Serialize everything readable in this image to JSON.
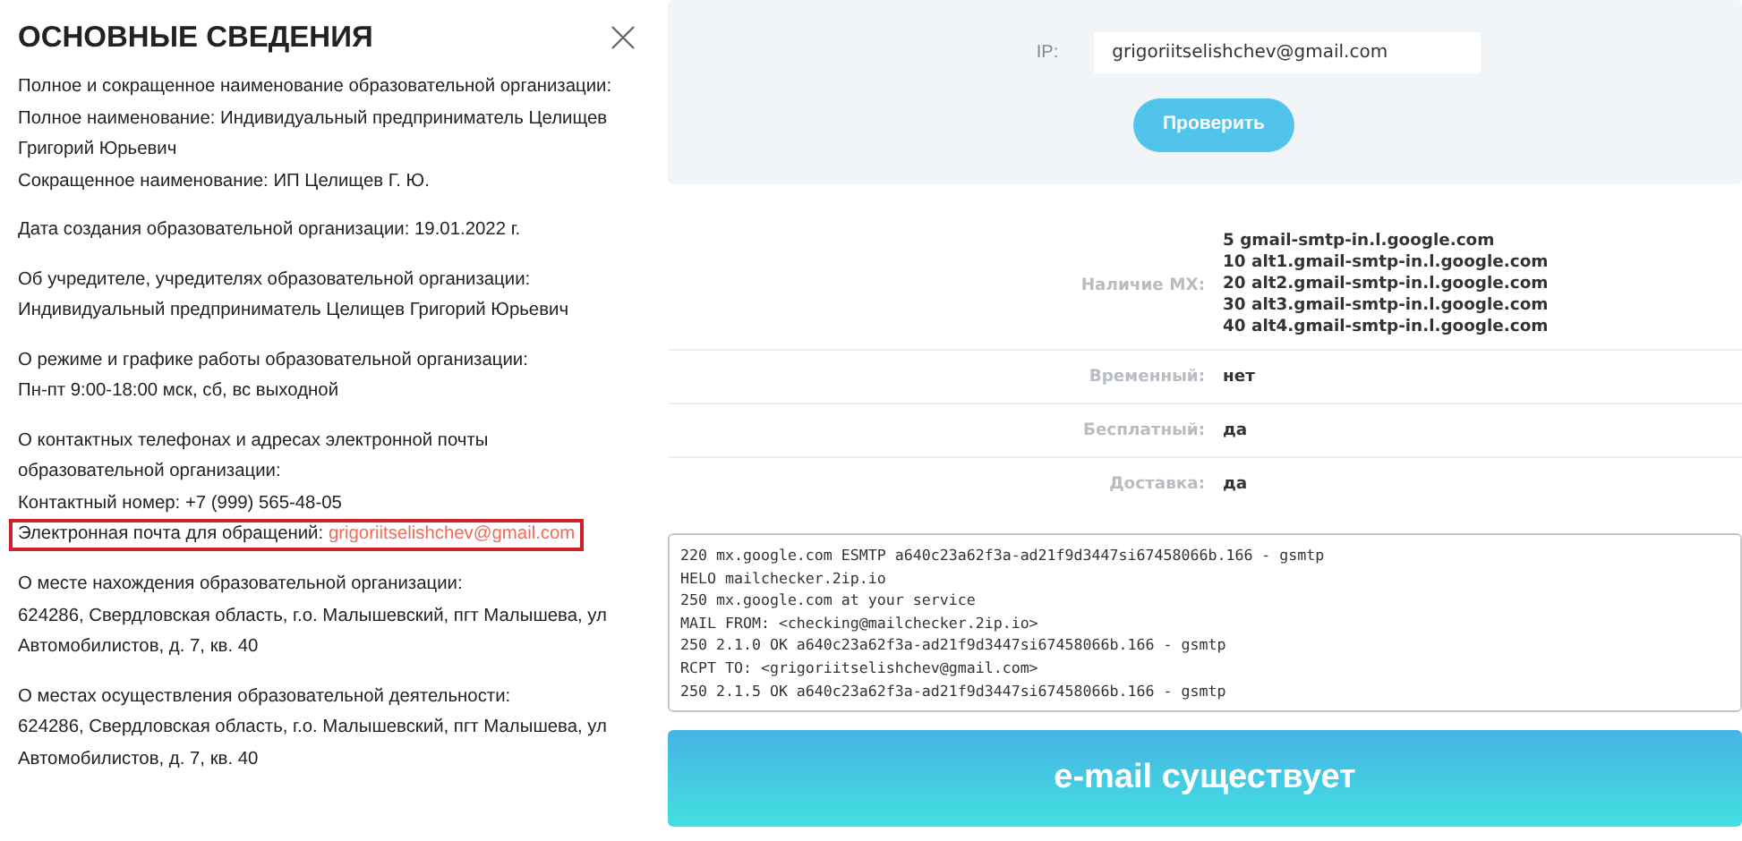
{
  "info_panel": {
    "title": "ОСНОВНЫЕ СВЕДЕНИЯ",
    "sections": [
      {
        "lines": [
          {
            "text": "Полное и сокращенное наименование образовательной организации:"
          },
          {
            "text": "Полное наименование: Индивидуальный предприниматель Целищев Григорий Юрьевич"
          },
          {
            "text": "Сокращенное наименование: ИП Целищев Г. Ю."
          }
        ]
      },
      {
        "lines": [
          {
            "text": "Дата создания образовательной организации: 19.01.2022 г."
          }
        ]
      },
      {
        "lines": [
          {
            "text": "Об учредителе, учредителях образовательной организации:"
          },
          {
            "text": "Индивидуальный предприниматель Целищев Григорий Юрьевич"
          }
        ]
      },
      {
        "lines": [
          {
            "text": "О режиме и графике работы образовательной организации:"
          },
          {
            "text": "Пн-пт 9:00-18:00 мск, сб, вс выходной"
          }
        ]
      },
      {
        "lines": [
          {
            "text": "О контактных телефонах и адресах электронной почты образовательной организации:"
          },
          {
            "text": "Контактный номер: +7 (999) 565-48-05"
          },
          {
            "text": "Электронная почта для обращений:",
            "link": "grigoriitselishchev@gmail.com",
            "highlighted": true
          }
        ]
      },
      {
        "lines": [
          {
            "text": "О месте нахождения образовательной организации:"
          },
          {
            "text": "624286, Свердловская область, г.о. Малышевский, пгт Малышева, ул Автомобилистов, д. 7, кв. 40"
          }
        ]
      },
      {
        "lines": [
          {
            "text": "О местах осуществления образовательной деятельности:"
          },
          {
            "text": "624286, Свердловская область, г.о. Малышевский, пгт Малышева, ул Автомобилистов, д. 7, кв. 40"
          }
        ]
      }
    ]
  },
  "checker": {
    "field_label": "IP:",
    "field_value": "grigoriitselishchev@gmail.com",
    "button": "Проверить",
    "results": [
      {
        "label": "Наличие MX:",
        "mx": [
          {
            "priority": "5",
            "host": "gmail-smtp-in.l.google.com"
          },
          {
            "priority": "10",
            "host": "alt1.gmail-smtp-in.l.google.com"
          },
          {
            "priority": "20",
            "host": "alt2.gmail-smtp-in.l.google.com"
          },
          {
            "priority": "30",
            "host": "alt3.gmail-smtp-in.l.google.com"
          },
          {
            "priority": "40",
            "host": "alt4.gmail-smtp-in.l.google.com"
          }
        ]
      },
      {
        "label": "Временный:",
        "value": "нет"
      },
      {
        "label": "Бесплатный:",
        "value": "да"
      },
      {
        "label": "Доставка:",
        "value": "да"
      }
    ],
    "log": [
      "220 mx.google.com ESMTP a640c23a62f3a-ad21f9d3447si67458066b.166 - gsmtp",
      "HELO mailchecker.2ip.io",
      "250 mx.google.com at your service",
      "MAIL FROM: <checking@mailchecker.2ip.io>",
      "250 2.1.0 OK a640c23a62f3a-ad21f9d3447si67458066b.166 - gsmtp",
      "RCPT TO: <grigoriitselishchev@gmail.com>",
      "250 2.1.5 OK a640c23a62f3a-ad21f9d3447si67458066b.166 - gsmtp"
    ],
    "verdict": "e-mail существует"
  }
}
